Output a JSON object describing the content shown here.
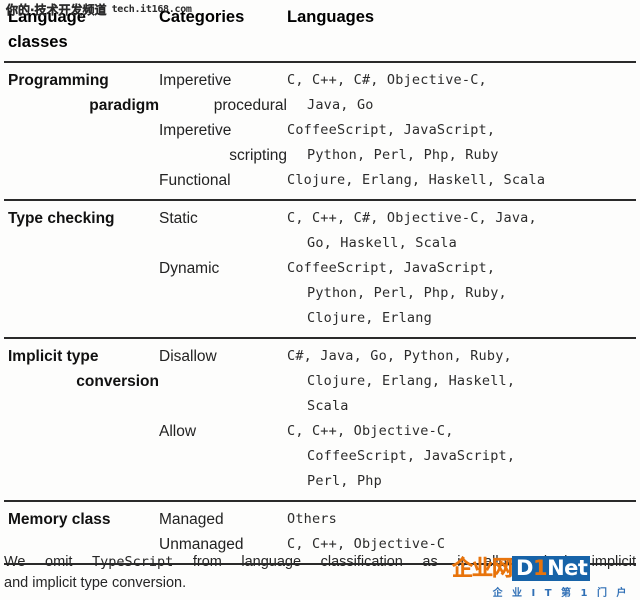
{
  "watermarks": {
    "top": {
      "channel": "你的·技术开发频道",
      "url": "tech.it168.com"
    },
    "logo": {
      "cn_prefix": "企业网",
      "brand_d": "D",
      "brand_one": "1",
      "brand_net": "Net",
      "tagline": "企 业 I T 第 1 门 户"
    }
  },
  "table": {
    "headers": {
      "class_line1": "Language",
      "class_line2": "classes",
      "categories": "Categories",
      "languages": "Languages"
    },
    "rows": [
      {
        "class_line1": "Programming",
        "class_line2": "paradigm",
        "groups": [
          {
            "cat_line1": "Imperetive",
            "cat_line2": "procedural",
            "lang_lines": [
              "C, C++, C#, Objective-C,",
              "Java, Go"
            ]
          },
          {
            "cat_line1": "Imperetive",
            "cat_line2": "scripting",
            "lang_lines": [
              "CoffeeScript, JavaScript,",
              "Python, Perl, Php, Ruby"
            ]
          },
          {
            "cat_line1": "Functional",
            "cat_line2": "",
            "lang_lines": [
              "Clojure, Erlang, Haskell, Scala"
            ]
          }
        ]
      },
      {
        "class_line1": "Type checking",
        "class_line2": "",
        "groups": [
          {
            "cat_line1": "Static",
            "cat_line2": "",
            "lang_lines": [
              "C, C++, C#, Objective-C, Java,",
              "Go, Haskell, Scala"
            ]
          },
          {
            "cat_line1": "Dynamic",
            "cat_line2": "",
            "lang_lines": [
              "CoffeeScript, JavaScript,",
              "Python, Perl, Php, Ruby,",
              "Clojure, Erlang"
            ]
          }
        ]
      },
      {
        "class_line1": "Implicit type",
        "class_line2": "conversion",
        "groups": [
          {
            "cat_line1": "Disallow",
            "cat_line2": "",
            "lang_lines": [
              "C#, Java, Go, Python, Ruby,",
              "Clojure, Erlang, Haskell,",
              "Scala"
            ]
          },
          {
            "cat_line1": "Allow",
            "cat_line2": "",
            "lang_lines": [
              "C, C++, Objective-C,",
              "CoffeeScript, JavaScript,",
              "Perl, Php"
            ]
          }
        ]
      },
      {
        "class_line1": "Memory class",
        "class_line2": "",
        "groups": [
          {
            "cat_line1": "Managed",
            "cat_line2": "",
            "lang_lines": [
              "Others"
            ]
          },
          {
            "cat_line1": "Unmanaged",
            "cat_line2": "",
            "lang_lines": [
              "C, C++, Objective-C"
            ]
          }
        ]
      }
    ]
  },
  "footnote": {
    "part1": "We omit ",
    "mono": "TypeScript",
    "part2": " from language classification as it allows both implicit",
    "line2": "and implicit type conversion."
  }
}
